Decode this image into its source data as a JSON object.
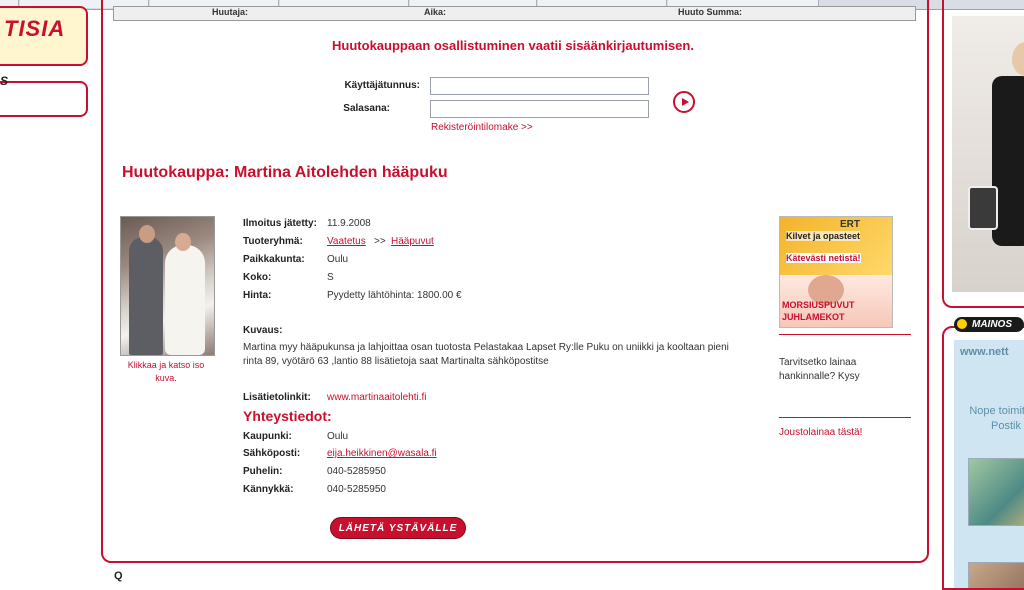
{
  "browser": {
    "tab_count": 7
  },
  "left": {
    "logo_text": "TISIA",
    "label": "S"
  },
  "headrow": {
    "col1": "Huutaja:",
    "col2": "Aika:",
    "col3": "Huuto Summa:"
  },
  "login": {
    "message": "Huutokauppaan osallistuminen vaatii sisäänkirjautumisen.",
    "username_label": "Käyttäjätunnus:",
    "username_value": "",
    "password_label": "Salasana:",
    "password_value": "",
    "register_link": "Rekisteröintilomake >>"
  },
  "auction": {
    "title": "Huutokauppa: Martina Aitolehden hääpuku",
    "photo_caption": "Klikkaa ja katso iso kuva.",
    "details": [
      {
        "key": "Ilmoitus jätetty:",
        "value": "11.9.2008"
      },
      {
        "key": "Tuoteryhmä:",
        "value_link1": "Vaatetus",
        "sep": ">>",
        "value_link2": "Hääpuvut"
      },
      {
        "key": "Paikkakunta:",
        "value": "Oulu"
      },
      {
        "key": "Koko:",
        "value": "S"
      },
      {
        "key": "Hinta:",
        "value": "Pyydetty lähtöhinta: 1800.00 €"
      }
    ],
    "description_label": "Kuvaus:",
    "description": "Martina myy hääpukunsa ja lahjoittaa osan tuotosta Pelastakaa Lapset Ry:lle Puku on uniikki ja kooltaan pieni rinta 89, vyötärö 63 ,lantio 88 lisätietoja saat Martinalta sähköpostitse",
    "more_links_label": "Lisätietolinkit:",
    "more_links_value": "www.martinaaitolehti.fi",
    "contact_title": "Yhteystiedot:",
    "contact": [
      {
        "key": "Kaupunki:",
        "value": "Oulu",
        "link": false
      },
      {
        "key": "Sähköposti:",
        "value": "eija.heikkinen@wasala.fi",
        "link": true
      },
      {
        "key": "Puhelin:",
        "value": "040-5285950",
        "link": false
      },
      {
        "key": "Kännykkä:",
        "value": "040-5285950",
        "link": false
      }
    ],
    "send_button": "LÄHETÄ YSTÄVÄLLE"
  },
  "side_ads": {
    "ad_line1": "Kilvet ja opasteet",
    "ad_line2": "Kätevästi netistä!",
    "ad_brand": "ERT",
    "ad_line3": "MORSIUSPUVUT",
    "ad_line4": "JUHLAMEKOT",
    "loan_text": "Tarvitsetko lainaa hankinnalle? Kysy",
    "loan_link": "Joustolainaa tästä!"
  },
  "right_column": {
    "label": "MAINOS",
    "site": "www.nett",
    "text": "Nope toimitu ei Postik"
  },
  "bottom": {
    "label": "Q"
  },
  "colors": {
    "accent": "#c8102e",
    "panel_bg": "#ffffff"
  }
}
